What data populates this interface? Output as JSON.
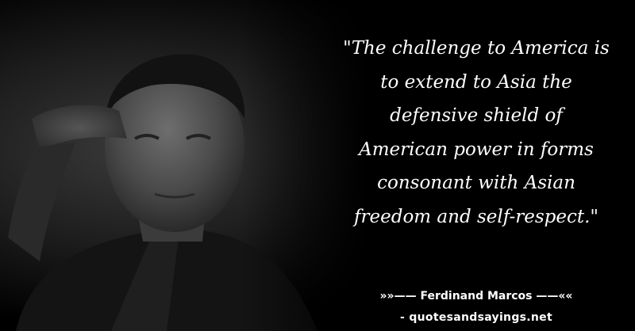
{
  "quote": {
    "lines": [
      "\"The challenge to America is",
      "to extend to Asia the",
      "defensive shield of",
      "American power in forms",
      "consonant with Asian",
      "freedom and self-respect.\""
    ]
  },
  "attribution": {
    "author_line": "»»—— Ferdinand Marcos ——««",
    "site_line": "- quotesandsayings.net"
  },
  "colors": {
    "background": "#000000",
    "text": "#ffffff"
  },
  "photo": {
    "icon": "saluting-man-portrait"
  }
}
